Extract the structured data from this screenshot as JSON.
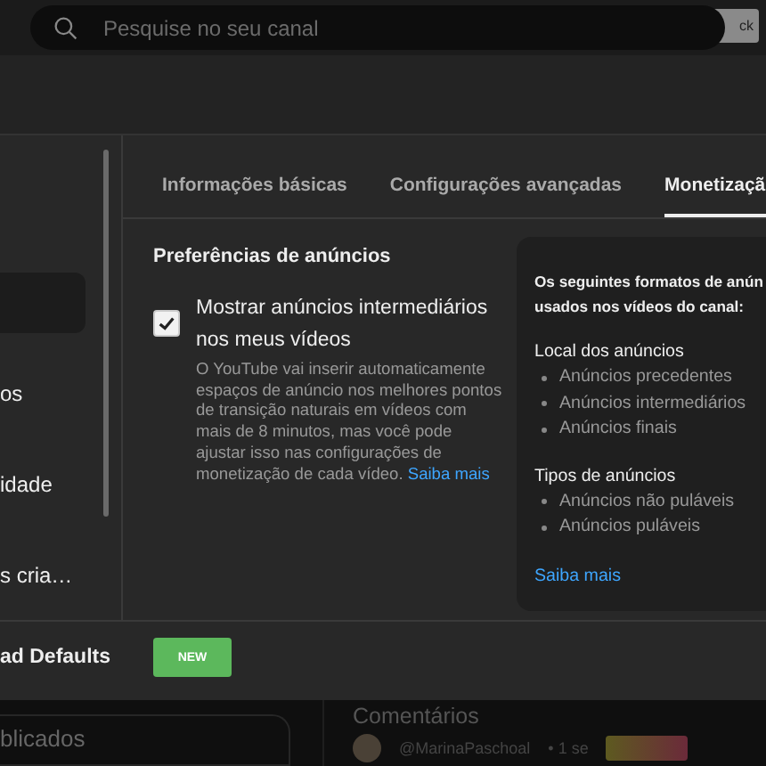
{
  "topbar": {
    "search": {
      "placeholder": "Pesquise no seu canal"
    },
    "button": "ck"
  },
  "sidebar": {
    "items": [
      {
        "selected": true
      },
      {
        "label": "os",
        "selected": false
      },
      {
        "label": "idade",
        "selected": false
      },
      {
        "label": "s cria…",
        "selected": false
      }
    ]
  },
  "tabs": [
    {
      "label": "Informações básicas",
      "selected": false
    },
    {
      "label": "Configurações avançadas",
      "selected": false
    },
    {
      "label": "Monetizaçã",
      "selected": true
    }
  ],
  "ad_preferences": {
    "title": "Preferências de anúncios",
    "checkbox": {
      "label": "Mostrar anúncios intermediários nos meus vídeos",
      "checked": true
    },
    "description": "O YouTube vai inserir automaticamente espaços de anúncio nos melhores pontos de transição naturais em vídeos com mais de 8 minutos, mas você pode ajustar isso nas configurações de monetização de cada vídeo.",
    "link": "Saiba mais"
  },
  "info_panel": {
    "intro": "Os seguintes formatos de anún",
    "intro_2": "usados nos vídeos do canal:",
    "sections": [
      {
        "title": "Local dos anúncios",
        "items": [
          "Anúncios precedentes",
          "Anúncios intermediários",
          "Anúncios finais"
        ]
      },
      {
        "title": "Tipos de anúncios",
        "items": [
          "Anúncios não puláveis",
          "Anúncios puláveis"
        ]
      }
    ],
    "link": "Saiba mais"
  },
  "footer": {
    "label": "ad Defaults",
    "badge": "NEW"
  },
  "page": {
    "left_heading": "blicados",
    "comments_heading": "Comentários",
    "comment": {
      "author": "@MarinaPaschoal",
      "time": "• 1 se"
    }
  }
}
